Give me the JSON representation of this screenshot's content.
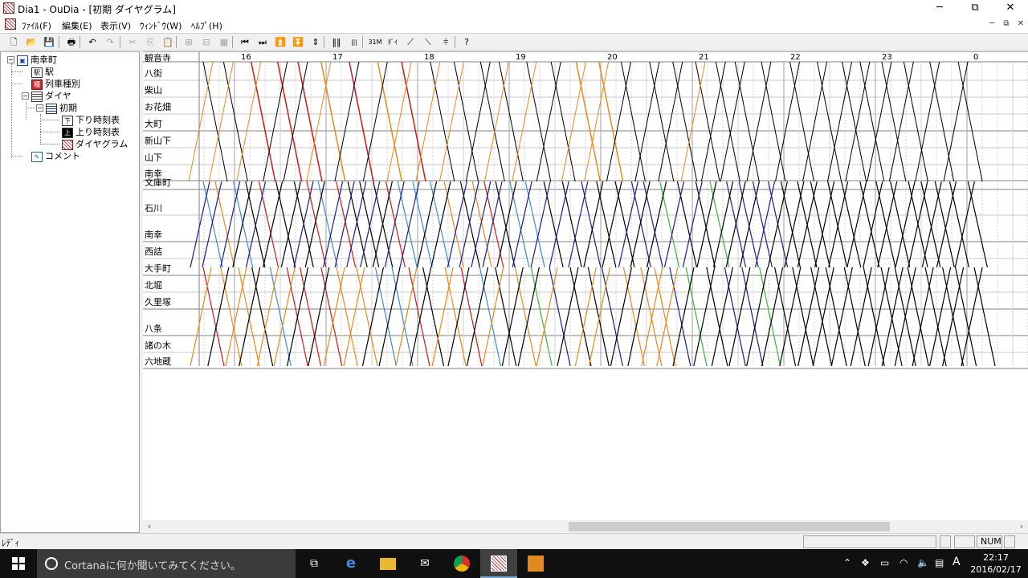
{
  "window": {
    "title": "Dia1 - OuDia - [初期 ダイヤグラム]",
    "minimize": "─",
    "restore": "⧉",
    "close": "✕"
  },
  "menubar": {
    "items": [
      "ﾌｧｲﾙ(F)",
      "編集(E)",
      "表示(V)",
      "ｳｨﾝﾄﾞｳ(W)",
      "ﾍﾙﾌﾟ(H)"
    ],
    "mdi_min": "─",
    "mdi_restore": "⧉",
    "mdi_close": "✕"
  },
  "toolbar": {
    "buttons": [
      {
        "name": "new-icon",
        "glyph": "🗋",
        "enabled": true
      },
      {
        "name": "open-icon",
        "glyph": "📂",
        "enabled": true
      },
      {
        "name": "save-icon",
        "glyph": "💾",
        "enabled": true
      },
      {
        "name": "print-icon",
        "glyph": "🖶",
        "enabled": true
      },
      {
        "name": "undo-icon",
        "glyph": "↶",
        "enabled": true
      },
      {
        "name": "redo-icon",
        "glyph": "↷",
        "enabled": false
      },
      {
        "name": "cut-icon",
        "glyph": "✂",
        "enabled": false
      },
      {
        "name": "copy-icon",
        "glyph": "⎘",
        "enabled": false
      },
      {
        "name": "paste-icon",
        "glyph": "📋",
        "enabled": false
      },
      {
        "name": "insert-row-icon",
        "glyph": "⊞",
        "enabled": false
      },
      {
        "name": "delete-row-icon",
        "glyph": "⊟",
        "enabled": false
      },
      {
        "name": "grid-icon",
        "glyph": "▦",
        "enabled": false
      },
      {
        "name": "first-icon",
        "glyph": "⏮",
        "enabled": true
      },
      {
        "name": "last-icon",
        "glyph": "⏭",
        "enabled": true
      },
      {
        "name": "top-icon",
        "glyph": "⏫",
        "enabled": true
      },
      {
        "name": "bottom-icon",
        "glyph": "⏬",
        "enabled": true
      },
      {
        "name": "middle-icon",
        "glyph": "⇕",
        "enabled": true
      },
      {
        "name": "vlines-icon",
        "glyph": "‖‖",
        "enabled": true
      },
      {
        "name": "vlines2-icon",
        "glyph": "|||",
        "enabled": true
      },
      {
        "name": "zoom-time-icon",
        "glyph": "31M",
        "enabled": true
      },
      {
        "name": "zoom-station-icon",
        "glyph": "ﾀﾞｲ",
        "enabled": true
      },
      {
        "name": "down-trains-icon",
        "glyph": "⟋",
        "enabled": true
      },
      {
        "name": "up-trains-icon",
        "glyph": "⟍",
        "enabled": true
      },
      {
        "name": "stop-lines-icon",
        "glyph": "⫩",
        "enabled": true
      },
      {
        "name": "help-icon",
        "glyph": "?",
        "enabled": true
      }
    ]
  },
  "tree": {
    "root": "南幸町",
    "station": "駅",
    "train_types": "列車種別",
    "dia": "ダイヤ",
    "initial": "初期",
    "down_timetable": "下り時刻表",
    "up_timetable": "上り時刻表",
    "diagram": "ダイヤグラム",
    "comment": "コメント"
  },
  "diagram": {
    "hours": [
      "16",
      "17",
      "18",
      "19",
      "20",
      "21",
      "22",
      "23",
      "0"
    ],
    "stations": [
      {
        "name": "観音寺",
        "major": true
      },
      {
        "name": "八街",
        "major": false
      },
      {
        "name": "柴山",
        "major": false
      },
      {
        "name": "お花畑",
        "major": false
      },
      {
        "name": "大町",
        "major": true
      },
      {
        "name": "新山下",
        "major": false
      },
      {
        "name": "山下",
        "major": false
      },
      {
        "name": "南幸",
        "major": true
      },
      {
        "name": "文庫町",
        "major": true
      },
      {
        "name": "石川",
        "major": false
      },
      {
        "name": "南幸",
        "major": true
      },
      {
        "name": "西詰",
        "major": false
      },
      {
        "name": "大手町",
        "major": true
      },
      {
        "name": "北堀",
        "major": false
      },
      {
        "name": "久里塚",
        "major": true
      },
      {
        "name": "八条",
        "major": true
      },
      {
        "name": "諸の木",
        "major": false
      },
      {
        "name": "六地蔵",
        "major": true
      }
    ],
    "colors": {
      "local": "#000000",
      "rapid": "#e88a1a",
      "express": "#d01818",
      "limited": "#1c1c8c",
      "green": "#3cb43c",
      "blue": "#3c8cd0"
    }
  },
  "statusbar": {
    "text": "ﾚﾃﾞｨ",
    "num": "NUM"
  },
  "taskbar": {
    "cortana": "Cortanaに何か聞いてみてください。",
    "ime": "A",
    "time": "22:17",
    "date": "2016/02/17"
  }
}
